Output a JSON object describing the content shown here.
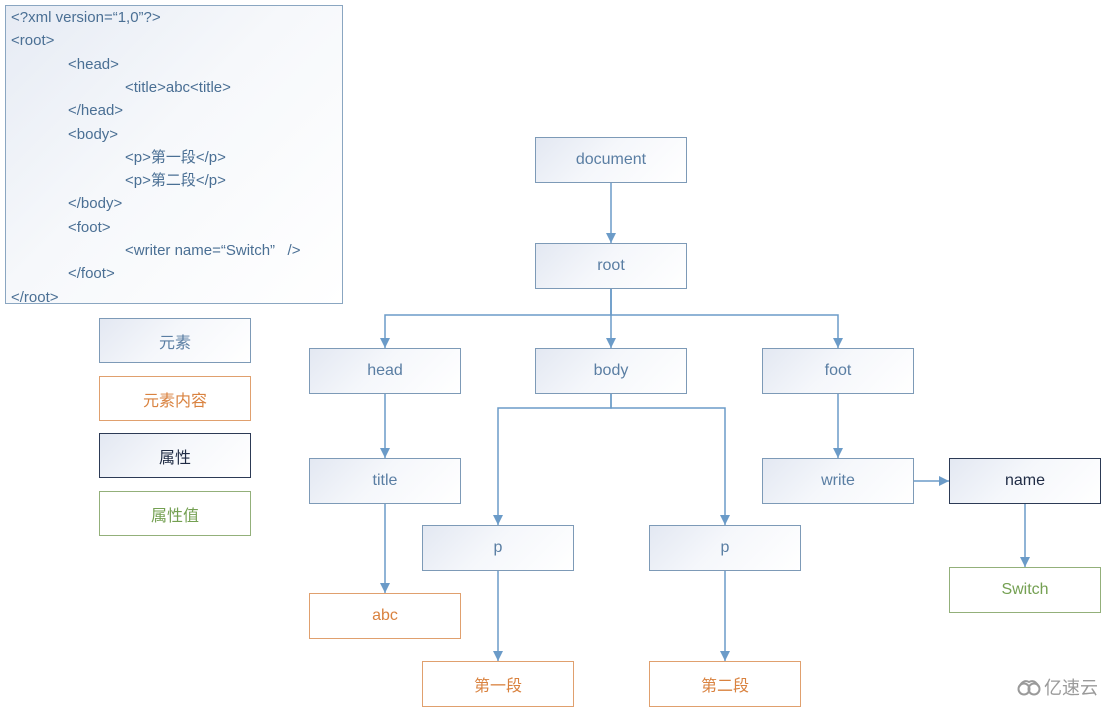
{
  "code": {
    "lines": [
      {
        "indent": 0,
        "text": "<?xml version=“1,0”?>"
      },
      {
        "indent": 0,
        "text": "<root>"
      },
      {
        "indent": 1,
        "text": "<head>"
      },
      {
        "indent": 2,
        "text": "<title>abc<title>"
      },
      {
        "indent": 1,
        "text": "</head>"
      },
      {
        "indent": 1,
        "text": "<body>"
      },
      {
        "indent": 2,
        "text": "<p>第一段</p>"
      },
      {
        "indent": 2,
        "text": "<p>第二段</p>"
      },
      {
        "indent": 1,
        "text": "</body>"
      },
      {
        "indent": 1,
        "text": "<foot>"
      },
      {
        "indent": 2,
        "text": "<writer name=“Switch”   />"
      },
      {
        "indent": 1,
        "text": "</foot>"
      },
      {
        "indent": 0,
        "text": "</root>"
      }
    ]
  },
  "legend": [
    {
      "kind": "element",
      "label": "元素"
    },
    {
      "kind": "content",
      "label": "元素内容"
    },
    {
      "kind": "attr",
      "label": "属性"
    },
    {
      "kind": "attrval",
      "label": "属性值"
    }
  ],
  "tree": {
    "nodes": [
      {
        "id": "document",
        "kind": "element",
        "label": "document"
      },
      {
        "id": "root",
        "kind": "element",
        "label": "root"
      },
      {
        "id": "head",
        "kind": "element",
        "label": "head"
      },
      {
        "id": "body",
        "kind": "element",
        "label": "body"
      },
      {
        "id": "foot",
        "kind": "element",
        "label": "foot"
      },
      {
        "id": "title",
        "kind": "element",
        "label": "title"
      },
      {
        "id": "write",
        "kind": "element",
        "label": "write"
      },
      {
        "id": "name",
        "kind": "attr",
        "label": "name"
      },
      {
        "id": "p1",
        "kind": "element",
        "label": "p"
      },
      {
        "id": "p2",
        "kind": "element",
        "label": "p"
      },
      {
        "id": "abc",
        "kind": "content",
        "label": "abc"
      },
      {
        "id": "switch",
        "kind": "attrval",
        "label": "Switch"
      },
      {
        "id": "seg1",
        "kind": "content",
        "label": "第一段"
      },
      {
        "id": "seg2",
        "kind": "content",
        "label": "第二段"
      }
    ],
    "edges": [
      [
        "document",
        "root"
      ],
      [
        "root",
        "head"
      ],
      [
        "root",
        "body"
      ],
      [
        "root",
        "foot"
      ],
      [
        "head",
        "title"
      ],
      [
        "title",
        "abc"
      ],
      [
        "body",
        "p1"
      ],
      [
        "body",
        "p2"
      ],
      [
        "p1",
        "seg1"
      ],
      [
        "p2",
        "seg2"
      ],
      [
        "foot",
        "write"
      ],
      [
        "write",
        "name"
      ],
      [
        "name",
        "switch"
      ]
    ]
  },
  "watermark": {
    "icon": "cloud-logo-icon",
    "text": "亿速云"
  },
  "colors": {
    "edge": "#6b9bc8",
    "element_border": "#7d9ab7",
    "content_border": "#e0a06e",
    "attr_border": "#2c3a55",
    "attrval_border": "#93b07a"
  }
}
